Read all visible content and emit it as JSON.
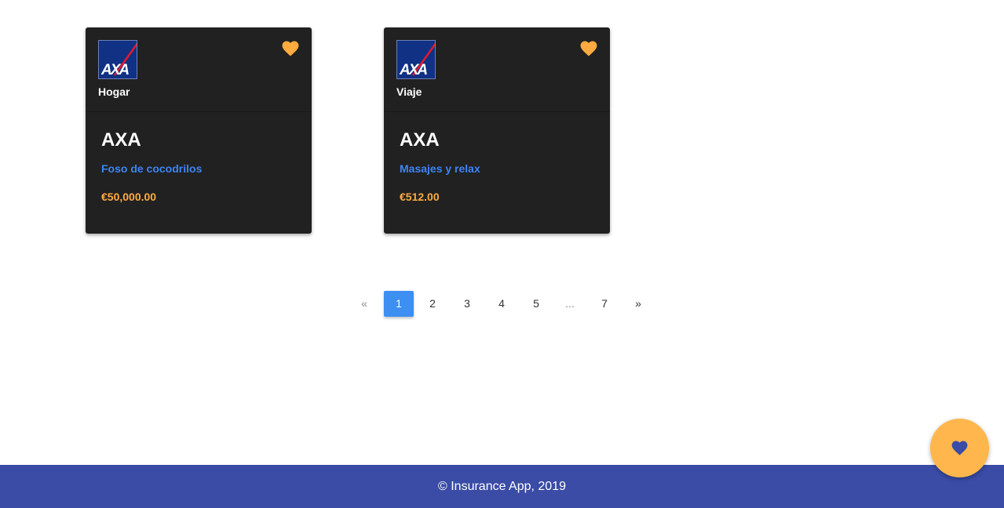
{
  "colors": {
    "card_background": "#212121",
    "favorite_icon": "#ffab40",
    "product_link": "#3d84f4",
    "price": "#ffab40",
    "pagination_active": "#3d8ff2",
    "footer_background": "#3a4ca6",
    "fab_background": "#ffb74d",
    "fab_icon": "#3a4ca6"
  },
  "cards": [
    {
      "logo_text": "AXA",
      "category": "Hogar",
      "company": "AXA",
      "product": "Foso de cocodrilos",
      "price": "€50,000.00",
      "favorite_icon": "heart-icon"
    },
    {
      "logo_text": "AXA",
      "category": "Viaje",
      "company": "AXA",
      "product": "Masajes y relax",
      "price": "€512.00",
      "favorite_icon": "heart-icon"
    }
  ],
  "pagination": {
    "prev": "«",
    "pages": [
      "1",
      "2",
      "3",
      "4",
      "5",
      "...",
      "7"
    ],
    "active": "1",
    "next": "»"
  },
  "footer": {
    "text": "© Insurance App, 2019"
  },
  "fab": {
    "icon": "heart-icon"
  }
}
